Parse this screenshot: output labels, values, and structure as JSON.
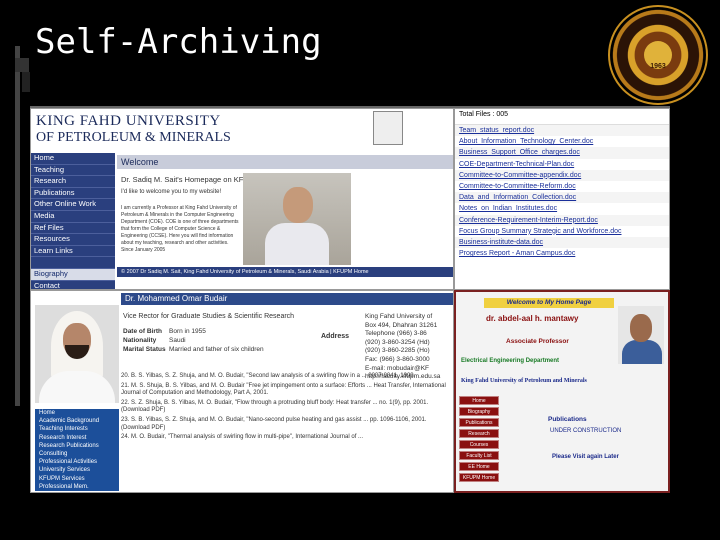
{
  "slide": {
    "title": "Self-Archiving"
  },
  "seal": {
    "ring_text": "KING FAHD UNIVERSITY OF PETROLEUM & MINERALS",
    "year": "1963"
  },
  "panel_a": {
    "univ_line1": "KING FAHD UNIVERSITY",
    "univ_line2": "OF PETROLEUM & MINERALS",
    "crest_label": "KING FAHD UNIVERSITY OF PETROLEUM & MINERALS",
    "nav": [
      "Home",
      "Teaching",
      "Research",
      "Publications",
      "Other Online Work",
      "Media",
      "Ref Files",
      "Resources",
      "Learn Links",
      "",
      "Biography",
      "Contact"
    ],
    "welcome": "Welcome",
    "homepage_title": "Dr. Sadiq M. Sait's Homepage on KFUPM",
    "intro": "I'd like to welcome you to my website!",
    "bio": "I am currently a Professor at King Fahd University of Petroleum & Minerals in the Computer Engineering Department (COE). COE is one of three departments that form the College of Computer Science & Engineering (CCSE). Here you will find information about my teaching, research and other activities. Since January 2005",
    "footer": "© 2007 Dr Sadiq M. Sait, King Fahd University of Petroleum & Minerals, Saudi Arabia | KFUPM Home"
  },
  "panel_b": {
    "total": "Total Files : 005",
    "files": [
      "Team_status_report.doc",
      "About_Information_Technology_Center.doc",
      "Business_Support_Office_charges.doc",
      "COE-Department-Technical-Plan.doc",
      "Committee-to-Committee-appendix.doc",
      "Committee-to-Committee-Reform.doc",
      "Data_and_Information_Collection.doc",
      "Notes_on_Indian_Institutes.doc",
      "Conference-Requirement-Interim-Report.doc",
      "Focus Group Summary Strategic and Workforce.doc",
      "Business-institute-data.doc",
      "Progress Report - Aman Campus.doc"
    ]
  },
  "panel_c": {
    "name": "Dr. Mohammed Omar Budair",
    "rector": "Vice Rector for Graduate Studies & Scientific Research",
    "dob_label": "Date of Birth",
    "dob": "Born in 1955",
    "nationality_label": "Nationality",
    "nationality": "Saudi",
    "marital_label": "Marital Status",
    "marital": "Married and father of six children",
    "address_label": "Address",
    "address_lines": [
      "King Fahd University of",
      "Box 494, Dhahran 31261",
      "Telephone (966) 3-86",
      "(920) 3-860-3254 (Hd)",
      "(920) 3-860-2285 (Ho)",
      "Fax: (966) 3-860-3000",
      "E-mail: mobudair@KF",
      "http://faculty.kfupm.edu.sa"
    ],
    "nav": [
      "Home",
      "Academic Background",
      "Teaching Interests",
      "Research Interest",
      "Research Publications",
      "Consulting",
      "Professional Activities",
      "University Services",
      "KFUPM Services",
      "Professional Mem."
    ],
    "publications": [
      "20. B. S. Yilbas, S. Z. Shuja, and M. O. Budair, \"Second law analysis of a swirling flow in a ... 0007-0041, 1999.",
      "21. M. S. Shuja, B. S. Yilbas, and M. O. Budair \"Free jet impingement onto a surface: Efforts ... Heat Transfer, International Journal of Computation and Methodology, Part A, 2001.",
      "22. S. Z. Shuja, B. S. Yilbas, M. O. Budair, \"Flow through a protruding bluff body: Heat transfer ... no. 1(9), pp. 2001. (Download PDF)",
      "23. S. B. Yilbas, S. Z. Shuja, and M. O. Budair, \"Nano-second pulse heating and gas assist ... pp. 1096-1106, 2001. (Download PDF)",
      "24. M. O. Budair, \"Thermal analysis of swirling flow in multi-pipe\", International Journal of ..."
    ]
  },
  "panel_d": {
    "welcome": "Welcome to My Home Page",
    "name": "dr. abdel-aal h. mantawy",
    "title": "Associate Professor",
    "department": "Electrical Engineering Department",
    "university": "King Fahd University of Petroleum and Minerals",
    "nav": [
      "Home",
      "Biography",
      "Publications",
      "Research",
      "Courses",
      "Faculty List",
      "EE Home",
      "KFUPM Home"
    ],
    "publications_heading": "Publications",
    "under_construction": "UNDER CONSTRUCTION",
    "visit_later": "Please Visit again Later"
  }
}
